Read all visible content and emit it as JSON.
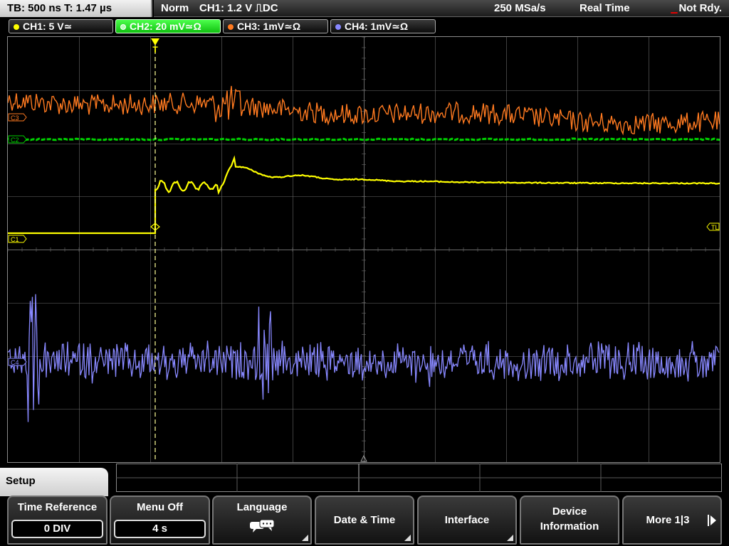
{
  "topbar": {
    "timebase": "TB: 500 ns   T: 1.47 µs",
    "mode": "Norm",
    "trigger": "CH1: 1.2 V ⎍DC",
    "sample_rate": "250 MSa/s",
    "acquisition": "Real Time",
    "trigger_state": "Not Rdy."
  },
  "channels": [
    {
      "label": "CH1: 5 V≃",
      "color": "#ffff00"
    },
    {
      "label": "CH2: 20 mV≃Ω",
      "color": "#00d000"
    },
    {
      "label": "CH3: 1mV≃Ω",
      "color": "#ff7a20"
    },
    {
      "label": "CH4: 1mV≃Ω",
      "color": "#8888ff"
    }
  ],
  "markers": {
    "c3": "C3",
    "c2": "C2",
    "c1": "C1",
    "c4": "C4",
    "tl": "TL",
    "trigger_pos": "T"
  },
  "colors": {
    "grid": "#6a6a6a",
    "trigger_line": "#ffff9a",
    "ch1": "#ffff00",
    "ch2": "#00d000",
    "ch3": "#ff7a20",
    "ch4": "#8888ff"
  },
  "menu": {
    "title": "Setup",
    "softkeys": {
      "time_reference": {
        "label": "Time Reference",
        "value": "0 DIV"
      },
      "menu_off": {
        "label": "Menu Off",
        "value": "4 s"
      },
      "language": {
        "label": "Language",
        "icon": "speech-bubbles-icon"
      },
      "date_time": {
        "label": "Date & Time"
      },
      "interface": {
        "label": "Interface"
      },
      "device_information": {
        "label1": "Device",
        "label2": "Information"
      },
      "more": {
        "label": "More 1|3"
      }
    }
  }
}
